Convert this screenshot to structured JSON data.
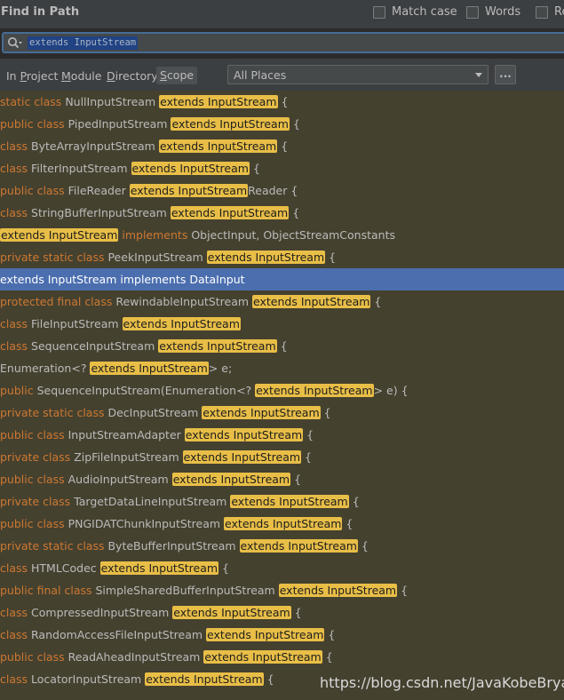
{
  "header": {
    "title": "Find in Path",
    "options": [
      {
        "label": "Match case",
        "checked": false
      },
      {
        "label": "Words",
        "checked": false
      },
      {
        "label": "Re",
        "checked": false
      }
    ]
  },
  "search": {
    "icon": "search-icon",
    "query": "extends InputStream"
  },
  "scope": {
    "tabs": [
      {
        "label": "In Project",
        "mnemonic": "P"
      },
      {
        "label": "Module",
        "mnemonic": "M"
      },
      {
        "label": "Directory",
        "mnemonic": "D"
      },
      {
        "label": "Scope",
        "mnemonic": "S",
        "active": true
      }
    ],
    "combo_value": "All Places",
    "more_button": "..."
  },
  "results": [
    [
      {
        "t": "kw",
        "v": "static class "
      },
      {
        "t": "n",
        "v": "NullInputStream "
      },
      {
        "t": "hl",
        "v": "extends InputStream"
      },
      {
        "t": "n",
        "v": " {"
      }
    ],
    [
      {
        "t": "kw",
        "v": "public class "
      },
      {
        "t": "n",
        "v": "PipedInputStream "
      },
      {
        "t": "hl",
        "v": "extends InputStream"
      },
      {
        "t": "n",
        "v": " {"
      }
    ],
    [
      {
        "t": "kw",
        "v": "class "
      },
      {
        "t": "n",
        "v": "ByteArrayInputStream "
      },
      {
        "t": "hl",
        "v": "extends InputStream"
      },
      {
        "t": "n",
        "v": " {"
      }
    ],
    [
      {
        "t": "kw",
        "v": "class "
      },
      {
        "t": "n",
        "v": "FilterInputStream "
      },
      {
        "t": "hl",
        "v": "extends InputStream"
      },
      {
        "t": "n",
        "v": " {"
      }
    ],
    [
      {
        "t": "kw",
        "v": "public class "
      },
      {
        "t": "n",
        "v": "FileReader "
      },
      {
        "t": "hl",
        "v": "extends InputStream"
      },
      {
        "t": "n",
        "v": "Reader {"
      }
    ],
    [
      {
        "t": "kw",
        "v": "class "
      },
      {
        "t": "n",
        "v": "StringBufferInputStream "
      },
      {
        "t": "hl",
        "v": "extends InputStream"
      },
      {
        "t": "n",
        "v": " {"
      }
    ],
    [
      {
        "t": "hl",
        "v": "extends InputStream"
      },
      {
        "t": "kw",
        "v": " implements "
      },
      {
        "t": "n",
        "v": "ObjectInput, ObjectStreamConstants"
      }
    ],
    [
      {
        "t": "kw",
        "v": "private static class "
      },
      {
        "t": "n",
        "v": "PeekInputStream "
      },
      {
        "t": "hl",
        "v": "extends InputStream"
      },
      {
        "t": "n",
        "v": " {"
      }
    ],
    [
      {
        "t": "hl",
        "v": "extends InputStream"
      },
      {
        "t": "kw",
        "v": " implements "
      },
      {
        "t": "n",
        "v": "DataInput"
      }
    ],
    [
      {
        "t": "kw",
        "v": "protected final class "
      },
      {
        "t": "n",
        "v": "RewindableInputStream "
      },
      {
        "t": "hl",
        "v": "extends InputStream"
      },
      {
        "t": "n",
        "v": " {"
      }
    ],
    [
      {
        "t": "kw",
        "v": "class "
      },
      {
        "t": "n",
        "v": "FileInputStream "
      },
      {
        "t": "hl",
        "v": "extends InputStream"
      }
    ],
    [
      {
        "t": "kw",
        "v": "class "
      },
      {
        "t": "n",
        "v": "SequenceInputStream "
      },
      {
        "t": "hl",
        "v": "extends InputStream"
      },
      {
        "t": "n",
        "v": " {"
      }
    ],
    [
      {
        "t": "n",
        "v": "Enumeration<? "
      },
      {
        "t": "hl",
        "v": "extends InputStream"
      },
      {
        "t": "n",
        "v": "> e;"
      }
    ],
    [
      {
        "t": "kw",
        "v": "public "
      },
      {
        "t": "n",
        "v": "SequenceInputStream(Enumeration<? "
      },
      {
        "t": "hl",
        "v": "extends InputStream"
      },
      {
        "t": "n",
        "v": "> e) {"
      }
    ],
    [
      {
        "t": "kw",
        "v": "private static class "
      },
      {
        "t": "n",
        "v": "DecInputStream "
      },
      {
        "t": "hl",
        "v": "extends InputStream"
      },
      {
        "t": "n",
        "v": " {"
      }
    ],
    [
      {
        "t": "kw",
        "v": "public class "
      },
      {
        "t": "n",
        "v": "InputStreamAdapter "
      },
      {
        "t": "hl",
        "v": "extends InputStream"
      },
      {
        "t": "n",
        "v": " {"
      }
    ],
    [
      {
        "t": "kw",
        "v": "private class "
      },
      {
        "t": "n",
        "v": "ZipFileInputStream "
      },
      {
        "t": "hl",
        "v": "extends InputStream"
      },
      {
        "t": "n",
        "v": " {"
      }
    ],
    [
      {
        "t": "kw",
        "v": "public class "
      },
      {
        "t": "n",
        "v": "AudioInputStream "
      },
      {
        "t": "hl",
        "v": "extends InputStream"
      },
      {
        "t": "n",
        "v": " {"
      }
    ],
    [
      {
        "t": "kw",
        "v": "private class "
      },
      {
        "t": "n",
        "v": "TargetDataLineInputStream "
      },
      {
        "t": "hl",
        "v": "extends InputStream"
      },
      {
        "t": "n",
        "v": " {"
      }
    ],
    [
      {
        "t": "kw",
        "v": "public class "
      },
      {
        "t": "n",
        "v": "PNGIDATChunkInputStream "
      },
      {
        "t": "hl",
        "v": "extends InputStream"
      },
      {
        "t": "n",
        "v": " {"
      }
    ],
    [
      {
        "t": "kw",
        "v": "private static class "
      },
      {
        "t": "n",
        "v": "ByteBufferInputStream "
      },
      {
        "t": "hl",
        "v": "extends InputStream"
      },
      {
        "t": "n",
        "v": " {"
      }
    ],
    [
      {
        "t": "kw",
        "v": "class "
      },
      {
        "t": "n",
        "v": "HTMLCodec "
      },
      {
        "t": "hl",
        "v": "extends InputStream"
      },
      {
        "t": "n",
        "v": " {"
      }
    ],
    [
      {
        "t": "kw",
        "v": "public final class "
      },
      {
        "t": "n",
        "v": "SimpleSharedBufferInputStream "
      },
      {
        "t": "hl",
        "v": "extends InputStream"
      },
      {
        "t": "n",
        "v": " {"
      }
    ],
    [
      {
        "t": "kw",
        "v": "class "
      },
      {
        "t": "n",
        "v": "CompressedInputStream "
      },
      {
        "t": "hl",
        "v": "extends InputStream"
      },
      {
        "t": "n",
        "v": " {"
      }
    ],
    [
      {
        "t": "kw",
        "v": "class "
      },
      {
        "t": "n",
        "v": "RandomAccessFileInputStream "
      },
      {
        "t": "hl",
        "v": "extends InputStream"
      },
      {
        "t": "n",
        "v": " {"
      }
    ],
    [
      {
        "t": "kw",
        "v": "public class "
      },
      {
        "t": "n",
        "v": "ReadAheadInputStream "
      },
      {
        "t": "hl",
        "v": "extends InputStream"
      },
      {
        "t": "n",
        "v": " {"
      }
    ],
    [
      {
        "t": "kw",
        "v": "class "
      },
      {
        "t": "n",
        "v": "LocatorInputStream "
      },
      {
        "t": "hl",
        "v": "extends InputStream"
      },
      {
        "t": "n",
        "v": " {"
      }
    ]
  ],
  "selected_row": 8,
  "watermark": "https://blog.csdn.net/JavaKobeBryant",
  "colors": {
    "keyword": "#cc7832",
    "highlight": "#e8be47",
    "selection": "#4b6eaf",
    "results_bg": "#45412f",
    "panel_bg": "#3c3f41"
  }
}
